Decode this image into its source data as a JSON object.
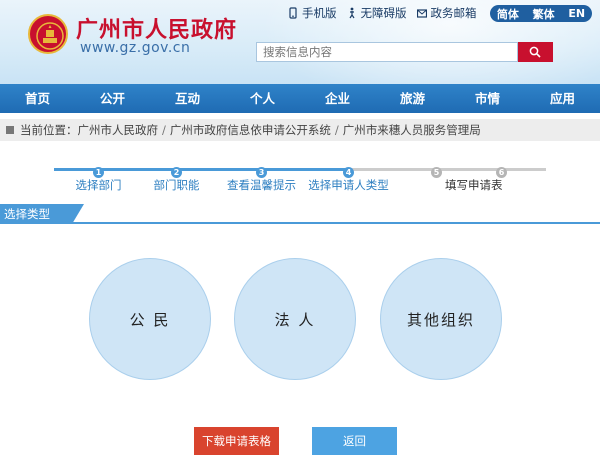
{
  "header": {
    "site_title": "广州市人民政府",
    "site_url": "www.gz.gov.cn",
    "links": [
      {
        "label": "手机版",
        "icon": "mobile-icon"
      },
      {
        "label": "无障碍版",
        "icon": "accessibility-icon"
      },
      {
        "label": "政务邮箱",
        "icon": "mail-icon"
      }
    ],
    "languages": [
      "简体",
      "繁体",
      "EN"
    ],
    "search": {
      "placeholder": "搜索信息内容",
      "button_icon": "search-icon"
    },
    "brand_color": "#c8102e"
  },
  "nav": {
    "items": [
      "首页",
      "公开",
      "互动",
      "个人",
      "企业",
      "旅游",
      "市情",
      "应用"
    ],
    "color": "#1f6bb3"
  },
  "breadcrumb": {
    "prefix": "当前位置：",
    "items": [
      "广州市人民政府",
      "广州市政府信息依申请公开系统",
      "广州市来穗人员服务管理局"
    ],
    "separator": "/"
  },
  "steps": {
    "items": [
      {
        "num": "1",
        "label": "选择部门",
        "state": "done"
      },
      {
        "num": "2",
        "label": "部门职能",
        "state": "done"
      },
      {
        "num": "3",
        "label": "查看温馨提示",
        "state": "done"
      },
      {
        "num": "4",
        "label": "选择申请人类型",
        "state": "done"
      },
      {
        "num": "5",
        "label": "",
        "state": "todo"
      },
      {
        "num": "6",
        "label": "填写申请表",
        "state": "todo"
      }
    ],
    "active_color": "#4a9ad8"
  },
  "section": {
    "title": "选择类型"
  },
  "types": [
    "公 民",
    "法 人",
    "其他组织"
  ],
  "buttons": {
    "download": "下载申请表格",
    "back": "返回"
  },
  "colors": {
    "download": "#d9442e",
    "back": "#4da3e2",
    "circle": "#cfe5f6"
  }
}
